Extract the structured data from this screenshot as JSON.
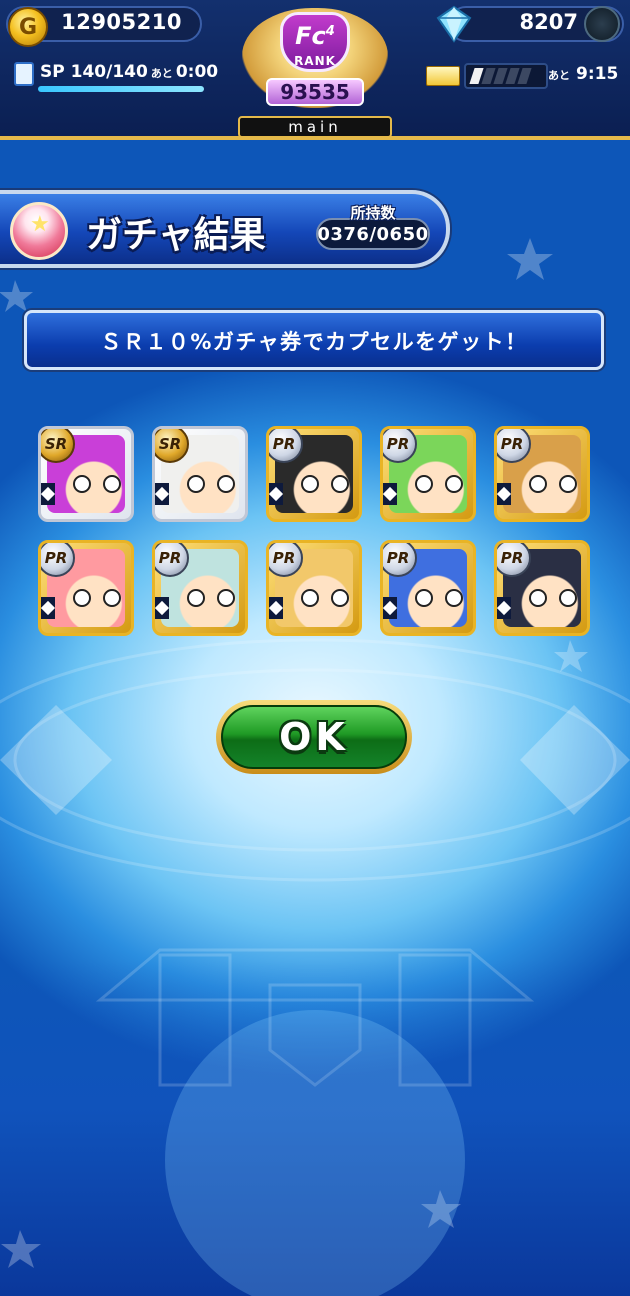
{
  "top_bar": {
    "coins": "12905210",
    "gems": "8207",
    "sp": {
      "label": "SP",
      "value": "140/140",
      "remaining_label": "あと",
      "time": "0:00",
      "fill": 1.0
    },
    "stamina": {
      "filled": 1,
      "total": 5,
      "remaining_label": "あと",
      "time": "9:15"
    },
    "rank": {
      "emblem_text": "Fc",
      "emblem_sup": "4",
      "label": "RANK",
      "value": "93535"
    },
    "tab_label": "main"
  },
  "header": {
    "title": "ガチャ結果",
    "owned_label": "所持数",
    "owned_value": "0376/0650"
  },
  "message": "ＳＲ１０%ガチャ券でカプセルをゲット！",
  "cards": [
    {
      "rarity": "SR",
      "color": "#c93fd8"
    },
    {
      "rarity": "SR",
      "color": "#f0f0ee"
    },
    {
      "rarity": "PR",
      "color": "#2a2a2a"
    },
    {
      "rarity": "PR",
      "color": "#7bd65a"
    },
    {
      "rarity": "PR",
      "color": "#d9a04a"
    },
    {
      "rarity": "PR",
      "color": "#ff9aa0"
    },
    {
      "rarity": "PR",
      "color": "#bfe3df"
    },
    {
      "rarity": "PR",
      "color": "#f2c86a"
    },
    {
      "rarity": "PR",
      "color": "#3f6fe0"
    },
    {
      "rarity": "PR",
      "color": "#2a2f44"
    }
  ],
  "ok_button": {
    "label": "OK"
  },
  "colors": {
    "accent_gold": "#e4b94a",
    "banner_blue": "#1447b8",
    "ok_green": "#1f9a25"
  }
}
